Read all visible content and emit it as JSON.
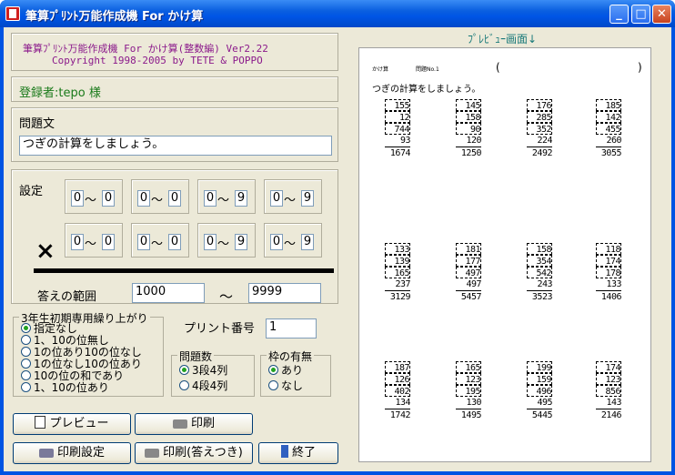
{
  "window": {
    "title": "筆算ﾌﾟﾘﾝﾄ万能作成機 For かけ算",
    "buttons": {
      "min": "_",
      "max": "□",
      "close": "✕"
    }
  },
  "version": {
    "line1": "筆算ﾌﾟﾘﾝﾄ万能作成機 For かけ算(整数編) Ver2.22",
    "line2": "Copyright 1998-2005 by TETE & POPPO"
  },
  "registered": "登録者:tepo 様",
  "question": {
    "label": "問題文",
    "value": "つぎの計算をしましょう。"
  },
  "settings": {
    "label": "設定",
    "tilde": "～",
    "times": "×",
    "row1": [
      {
        "lo": "0",
        "hi": "0"
      },
      {
        "lo": "0",
        "hi": "0"
      },
      {
        "lo": "0",
        "hi": "9"
      },
      {
        "lo": "0",
        "hi": "9"
      }
    ],
    "row2": [
      {
        "lo": "0",
        "hi": "0"
      },
      {
        "lo": "0",
        "hi": "0"
      },
      {
        "lo": "0",
        "hi": "9"
      },
      {
        "lo": "0",
        "hi": "9"
      }
    ],
    "answer_label": "答えの範囲",
    "answer_min": "1000",
    "answer_max": "9999",
    "answer_tilde": "～"
  },
  "carry": {
    "title": "3年生初期専用繰り上がり",
    "options": [
      "指定なし",
      "1、10の位無し",
      "1の位あり10の位なし",
      "1の位なし10の位あり",
      "10の位の和であり",
      "1、10の位あり"
    ],
    "selected": 0
  },
  "print_number": {
    "label": "プリント番号",
    "value": "1"
  },
  "problem_count": {
    "title": "問題数",
    "options": [
      "3段4列",
      "4段4列"
    ],
    "selected": 0
  },
  "frame": {
    "title": "枠の有無",
    "options": [
      "あり",
      "なし"
    ],
    "selected": 0
  },
  "buttons": {
    "preview": "プレビュー",
    "print": "印刷",
    "print_settings": "印刷設定",
    "print_answers": "印刷(答えつき)",
    "exit": "終了"
  },
  "preview": {
    "title": "ﾌﾟﾚﾋﾞｭｰ画面↓",
    "head1": "かけ算",
    "head2": "問題No.1",
    "paren_l": "(",
    "paren_r": ")",
    "question": "つぎの計算をしましょう。",
    "problems": [
      [
        "155",
        "12",
        "744",
        "93",
        "1674"
      ],
      [
        "145",
        "158",
        "90",
        "120",
        "1250"
      ],
      [
        "176",
        "285",
        "352",
        "224",
        "2492"
      ],
      [
        "185",
        "142",
        "455",
        "260",
        "3055"
      ],
      [
        "133",
        "139",
        "165",
        "237",
        "3129"
      ],
      [
        "181",
        "177",
        "497",
        "497",
        "5457"
      ],
      [
        "158",
        "354",
        "542",
        "243",
        "3523"
      ],
      [
        "118",
        "174",
        "178",
        "133",
        "1406"
      ],
      [
        "187",
        "126",
        "402",
        "134",
        "1742"
      ],
      [
        "165",
        "123",
        "195",
        "130",
        "1495"
      ],
      [
        "199",
        "159",
        "496",
        "495",
        "5445"
      ],
      [
        "174",
        "123",
        "856",
        "143",
        "2146"
      ]
    ]
  },
  "colors": {
    "titlebar": "#0055e5",
    "face": "#ece9d8",
    "version_text": "#8b1a8b",
    "registered_text": "#1a7a1a",
    "preview_title": "#1a7a7a"
  }
}
